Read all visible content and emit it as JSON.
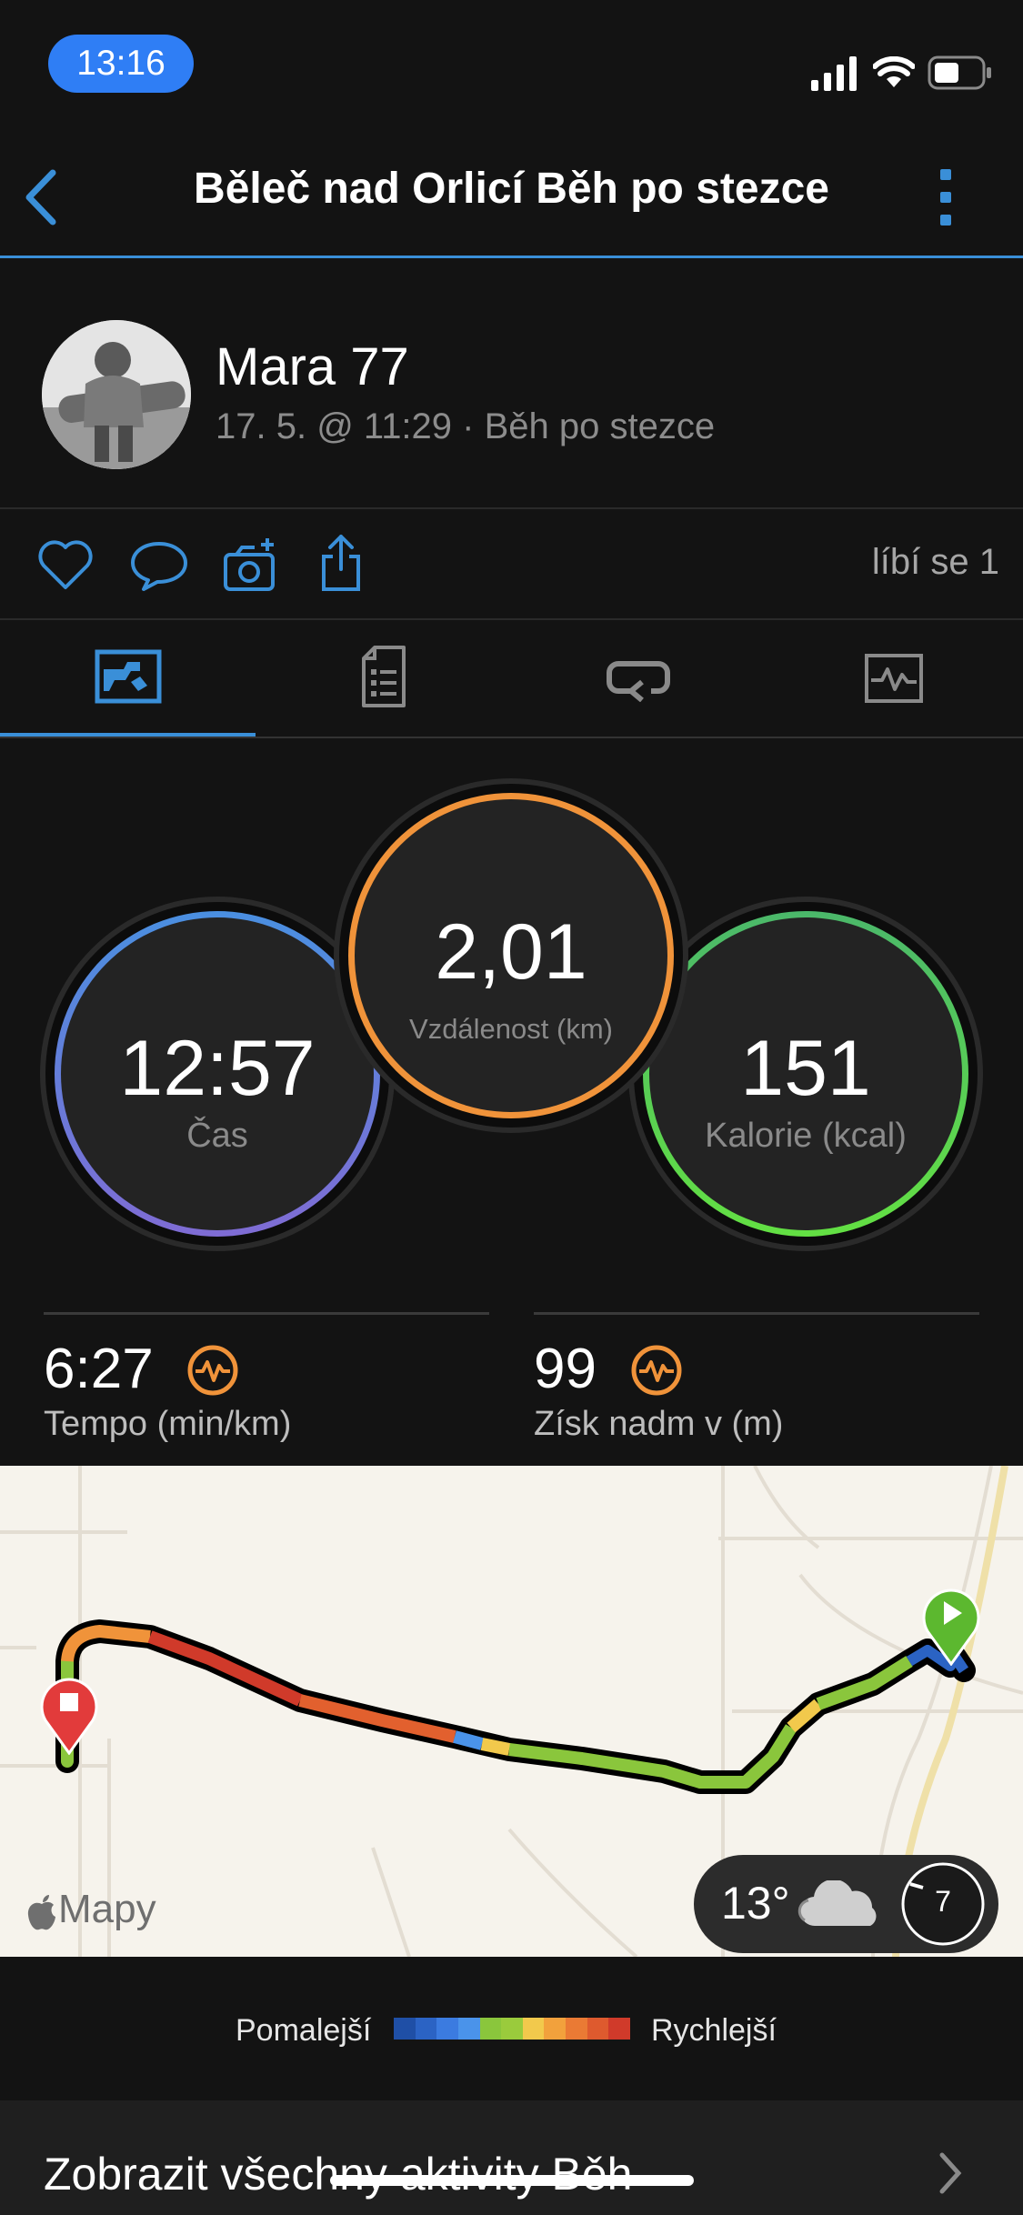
{
  "status_bar": {
    "time": "13:16"
  },
  "header": {
    "title": "Běleč nad Orlicí Běh po stezce"
  },
  "profile": {
    "name": "Mara 77",
    "subtitle": "17. 5. @ 11:29 · Běh po stezce"
  },
  "actions": {
    "likes": "líbí se 1"
  },
  "tabs": [
    {
      "icon": "summary-icon",
      "active": true
    },
    {
      "icon": "details-icon",
      "active": false
    },
    {
      "icon": "laps-icon",
      "active": false
    },
    {
      "icon": "charts-icon",
      "active": false
    }
  ],
  "rings": {
    "time": {
      "value": "12:57",
      "label": "Čas"
    },
    "distance": {
      "value": "2,01",
      "label": "Vzdálenost (km)"
    },
    "calories": {
      "value": "151",
      "label": "Kalorie (kcal)"
    }
  },
  "stats": {
    "pace": {
      "value": "6:27",
      "label": "Tempo (min/km)"
    },
    "elevation": {
      "value": "99",
      "label": "Získ nadm v (m)"
    }
  },
  "map": {
    "attribution": "Mapy",
    "weather": {
      "temp": "13°",
      "wind": "7"
    }
  },
  "legend": {
    "slower": "Pomalejší",
    "faster": "Rychlejší",
    "colors": [
      "#1f4fa6",
      "#2b63c4",
      "#3b7be0",
      "#4a93ea",
      "#8ac63c",
      "#9acb3c",
      "#f2c94c",
      "#f2a13c",
      "#ea7a34",
      "#de5a2e",
      "#d03a2a"
    ]
  },
  "bottom": {
    "label": "Zobrazit všechny aktivity Běh"
  }
}
